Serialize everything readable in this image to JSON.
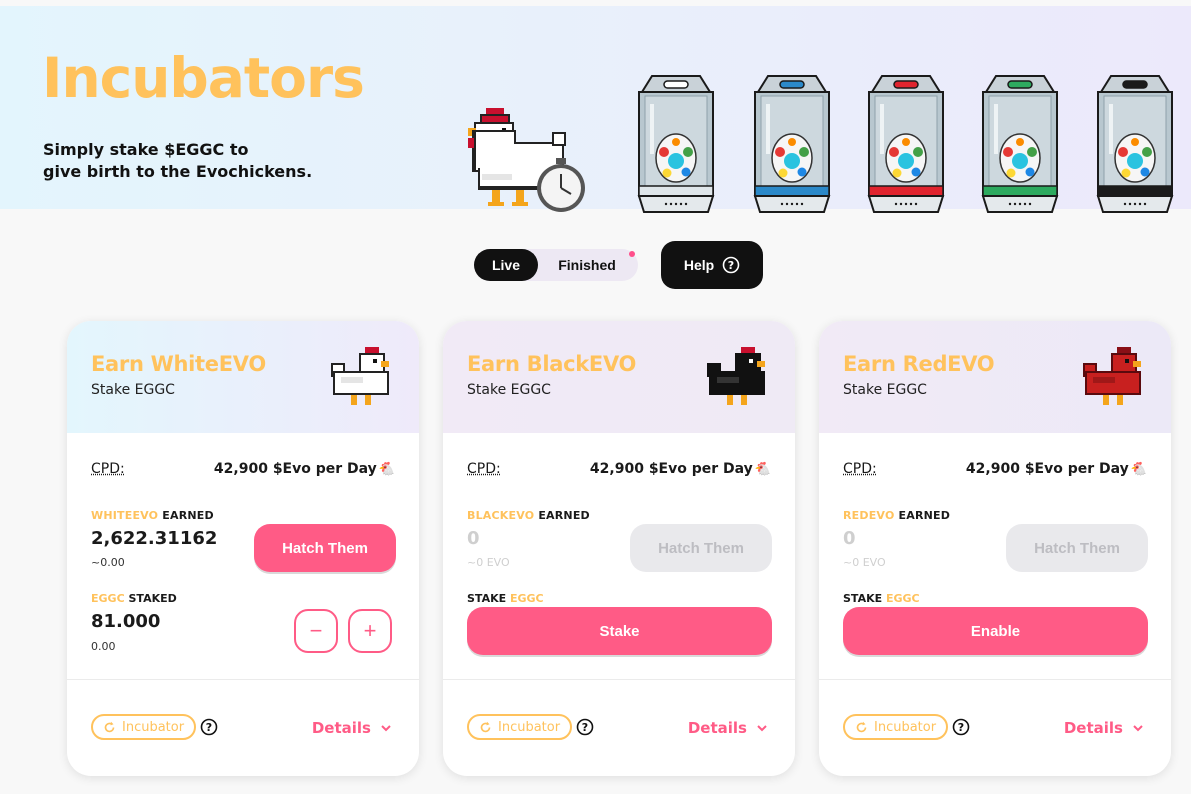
{
  "hero": {
    "title": "Incubators",
    "subtitle_line1": "Simply stake $EGGC to",
    "subtitle_line2": "give birth to the Evochickens.",
    "incubator_colors": [
      "#ffffff",
      "#2b89c9",
      "#e0242e",
      "#2daa5f",
      "#1b1b1b"
    ]
  },
  "toggle": {
    "live_label": "Live",
    "finished_label": "Finished"
  },
  "help": {
    "label": "Help"
  },
  "cards": [
    {
      "title": "Earn WhiteEVO",
      "subtitle": "Stake EGGC",
      "chicken_color": "white",
      "cpd_label": "CPD:",
      "cpd_value": "42,900 $Evo per Day",
      "earned_token": "WHITEEVO",
      "earned_suffix": "EARNED",
      "earned_value": "2,622.31162",
      "earned_usd": "~0.00",
      "hatch_label": "Hatch Them",
      "staked_token": "EGGC",
      "staked_suffix": "STAKED",
      "staked_value": "81.000",
      "staked_usd": "0.00",
      "minus_label": "−",
      "plus_label": "+",
      "incubator_label": "Incubator",
      "details_label": "Details"
    },
    {
      "title": "Earn BlackEVO",
      "subtitle": "Stake EGGC",
      "chicken_color": "black",
      "cpd_label": "CPD:",
      "cpd_value": "42,900 $Evo per Day",
      "earned_token": "BLACKEVO",
      "earned_suffix": "EARNED",
      "earned_value": "0",
      "earned_usd": "~0 EVO",
      "hatch_label": "Hatch Them",
      "stake_prefix": "STAKE",
      "staked_token": "EGGC",
      "action_label": "Stake",
      "incubator_label": "Incubator",
      "details_label": "Details"
    },
    {
      "title": "Earn RedEVO",
      "subtitle": "Stake EGGC",
      "chicken_color": "red",
      "cpd_label": "CPD:",
      "cpd_value": "42,900 $Evo per Day",
      "earned_token": "REDEVO",
      "earned_suffix": "EARNED",
      "earned_value": "0",
      "earned_usd": "~0 EVO",
      "hatch_label": "Hatch Them",
      "stake_prefix": "STAKE",
      "staked_token": "EGGC",
      "action_label": "Enable",
      "incubator_label": "Incubator",
      "details_label": "Details"
    }
  ],
  "colors": {
    "accent_pink": "#ff5b86",
    "accent_yellow": "#ffc25c",
    "dark": "#111111"
  }
}
